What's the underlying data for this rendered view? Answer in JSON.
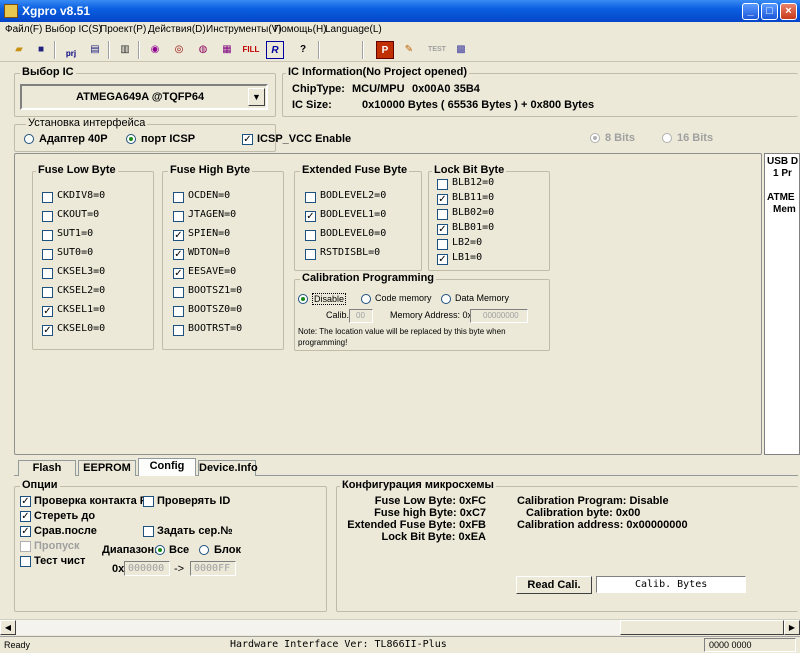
{
  "window": {
    "title": "Xgpro v8.51"
  },
  "menu": [
    "Файл(F)",
    "Выбор IC(S)",
    "Проект(P)",
    "Действия(D)",
    "Инструменты(V)",
    "Помощь(H)",
    "Language(L)"
  ],
  "toolbar": {
    "icons": [
      "open-icon",
      "save-icon",
      "project-icon",
      "save-project-icon",
      "chip-icon",
      "read-icon",
      "verify-icon",
      "blank-check-icon",
      "erase-icon",
      "fill-icon",
      "program-icon",
      "help-icon",
      "protect-icon",
      "edit-icon",
      "test-icon",
      "chip-select-icon"
    ],
    "fill_label": "FILL",
    "prj_label": "prj",
    "test_label": "TEST"
  },
  "ic_select": {
    "label": "Выбор IC",
    "value": "ATMEGA649A @TQFP64"
  },
  "ic_info": {
    "label": "IC Information(No Project opened)",
    "chip_type_label": "ChipType:",
    "chip_type_value": "MCU/MPU",
    "chip_id": "0x00A0 35B4",
    "ic_size_label": "IC Size:",
    "ic_size_value": "0x10000 Bytes ( 65536 Bytes ) + 0x800 Bytes"
  },
  "interface": {
    "label": "Установка интерфейса",
    "adapter_label": "Адаптер 40P",
    "port_label": "порт ICSP",
    "vcc_label": "ICSP_VCC Enable",
    "bits8": "8 Bits",
    "bits16": "16 Bits"
  },
  "fuse_low": {
    "label": "Fuse Low Byte",
    "items": [
      {
        "name": "CKDIV8=0",
        "checked": false
      },
      {
        "name": "CKOUT=0",
        "checked": false
      },
      {
        "name": "SUT1=0",
        "checked": false
      },
      {
        "name": "SUT0=0",
        "checked": false
      },
      {
        "name": "CKSEL3=0",
        "checked": false
      },
      {
        "name": "CKSEL2=0",
        "checked": false
      },
      {
        "name": "CKSEL1=0",
        "checked": true
      },
      {
        "name": "CKSEL0=0",
        "checked": true
      }
    ]
  },
  "fuse_high": {
    "label": "Fuse High Byte",
    "items": [
      {
        "name": "OCDEN=0",
        "checked": false
      },
      {
        "name": "JTAGEN=0",
        "checked": false
      },
      {
        "name": "SPIEN=0",
        "checked": true
      },
      {
        "name": "WDTON=0",
        "checked": true
      },
      {
        "name": "EESAVE=0",
        "checked": true
      },
      {
        "name": "BOOTSZ1=0",
        "checked": false
      },
      {
        "name": "BOOTSZ0=0",
        "checked": false
      },
      {
        "name": "BOOTRST=0",
        "checked": false
      }
    ]
  },
  "ext_fuse": {
    "label": "Extended Fuse Byte",
    "items": [
      {
        "name": "BODLEVEL2=0",
        "checked": false
      },
      {
        "name": "BODLEVEL1=0",
        "checked": true
      },
      {
        "name": "BODLEVEL0=0",
        "checked": false
      },
      {
        "name": "RSTDISBL=0",
        "checked": false
      }
    ]
  },
  "lock_bits": {
    "label": "Lock Bit Byte",
    "items": [
      {
        "name": "BLB12=0",
        "checked": false
      },
      {
        "name": "BLB11=0",
        "checked": true
      },
      {
        "name": "BLB02=0",
        "checked": false
      },
      {
        "name": "BLB01=0",
        "checked": true
      },
      {
        "name": "LB2=0",
        "checked": false
      },
      {
        "name": "LB1=0",
        "checked": true
      }
    ]
  },
  "calibration": {
    "label": "Calibration Programming",
    "disable": "Disable",
    "code_memory": "Code memory",
    "data_memory": "Data Memory",
    "calib_label": "Calib.",
    "calib_value": "00",
    "mem_addr_label": "Memory Address: 0x",
    "mem_addr_value": "00000000",
    "note": "Note: The location value will be replaced by this byte  when programming!"
  },
  "side_panel": {
    "line1": "USB D",
    "line2": "1  Pr",
    "line3": "ATME",
    "line4": "Mem"
  },
  "tabs": [
    "Flash",
    "EEPROM",
    "Config",
    "Device.Info"
  ],
  "options": {
    "label": "Опции",
    "check_pins": "Проверка контакта PI",
    "check_id": "Проверять ID",
    "erase_before": "Стереть до",
    "compare_after": "Срав.после",
    "set_serial": "Задать сер.№",
    "skip": "Пропуск",
    "blank_test": "Тест чист",
    "range_label": "Диапазон:",
    "range_all": "Все",
    "range_block": "Блок",
    "prefix": "0x",
    "from_value": "000000",
    "arrow": "->",
    "to_value": "0000FF"
  },
  "chip_config": {
    "label": "Конфигурация микросхемы",
    "fuse_low": "Fuse Low Byte: 0xFC",
    "fuse_high": "Fuse high Byte: 0xC7",
    "ext_fuse": "Extended Fuse Byte: 0xFB",
    "lock_bit": "Lock Bit Byte: 0xEA",
    "cal_program": "Calibration Program: Disable",
    "cal_byte": "Calibration byte: 0x00",
    "cal_address": "Calibration address: 0x00000000",
    "read_cali": "Read Cali.",
    "calib_bytes": "Calib. Bytes"
  },
  "status": {
    "ready": "Ready",
    "hw": "Hardware Interface Ver: TL866II-Plus",
    "counter": "0000 0000"
  }
}
